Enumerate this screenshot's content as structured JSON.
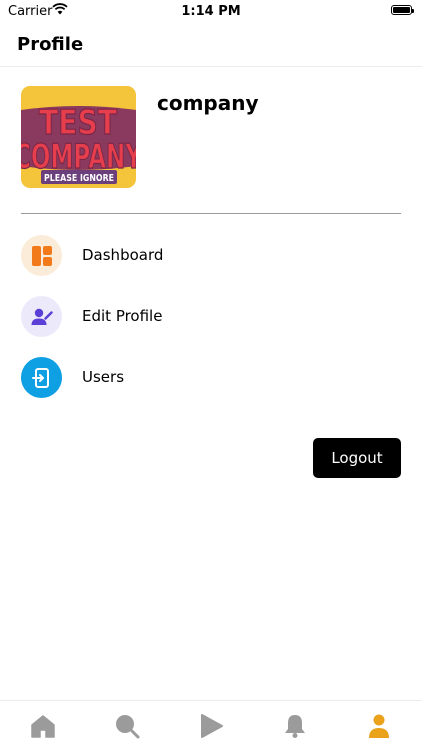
{
  "status_bar": {
    "carrier": "Carrier",
    "time": "1:14 PM"
  },
  "header": {
    "title": "Profile"
  },
  "company": {
    "name": "company",
    "logo": {
      "line1": "TEST",
      "line2": "COMPANY",
      "line3": "PLEASE IGNORE"
    }
  },
  "menu": {
    "items": [
      {
        "label": "Dashboard",
        "icon": "dashboard-icon",
        "icon_bg": "#fbecd9",
        "icon_color": "#f27a1a"
      },
      {
        "label": "Edit Profile",
        "icon": "edit-profile-icon",
        "icon_bg": "#ece9fb",
        "icon_color": "#5b3fd6"
      },
      {
        "label": "Users",
        "icon": "users-icon",
        "icon_bg": "#0f9fe3",
        "icon_color": "#ffffff"
      }
    ]
  },
  "logout": {
    "label": "Logout"
  },
  "tab_bar": {
    "tabs": [
      {
        "name": "home",
        "icon": "home-icon",
        "active": false
      },
      {
        "name": "search",
        "icon": "search-icon",
        "active": false
      },
      {
        "name": "play",
        "icon": "play-icon",
        "active": false
      },
      {
        "name": "notifications",
        "icon": "bell-icon",
        "active": false
      },
      {
        "name": "profile",
        "icon": "profile-icon",
        "active": true
      }
    ],
    "inactive_color": "#9b9b9b",
    "active_color": "#e9a21a"
  }
}
